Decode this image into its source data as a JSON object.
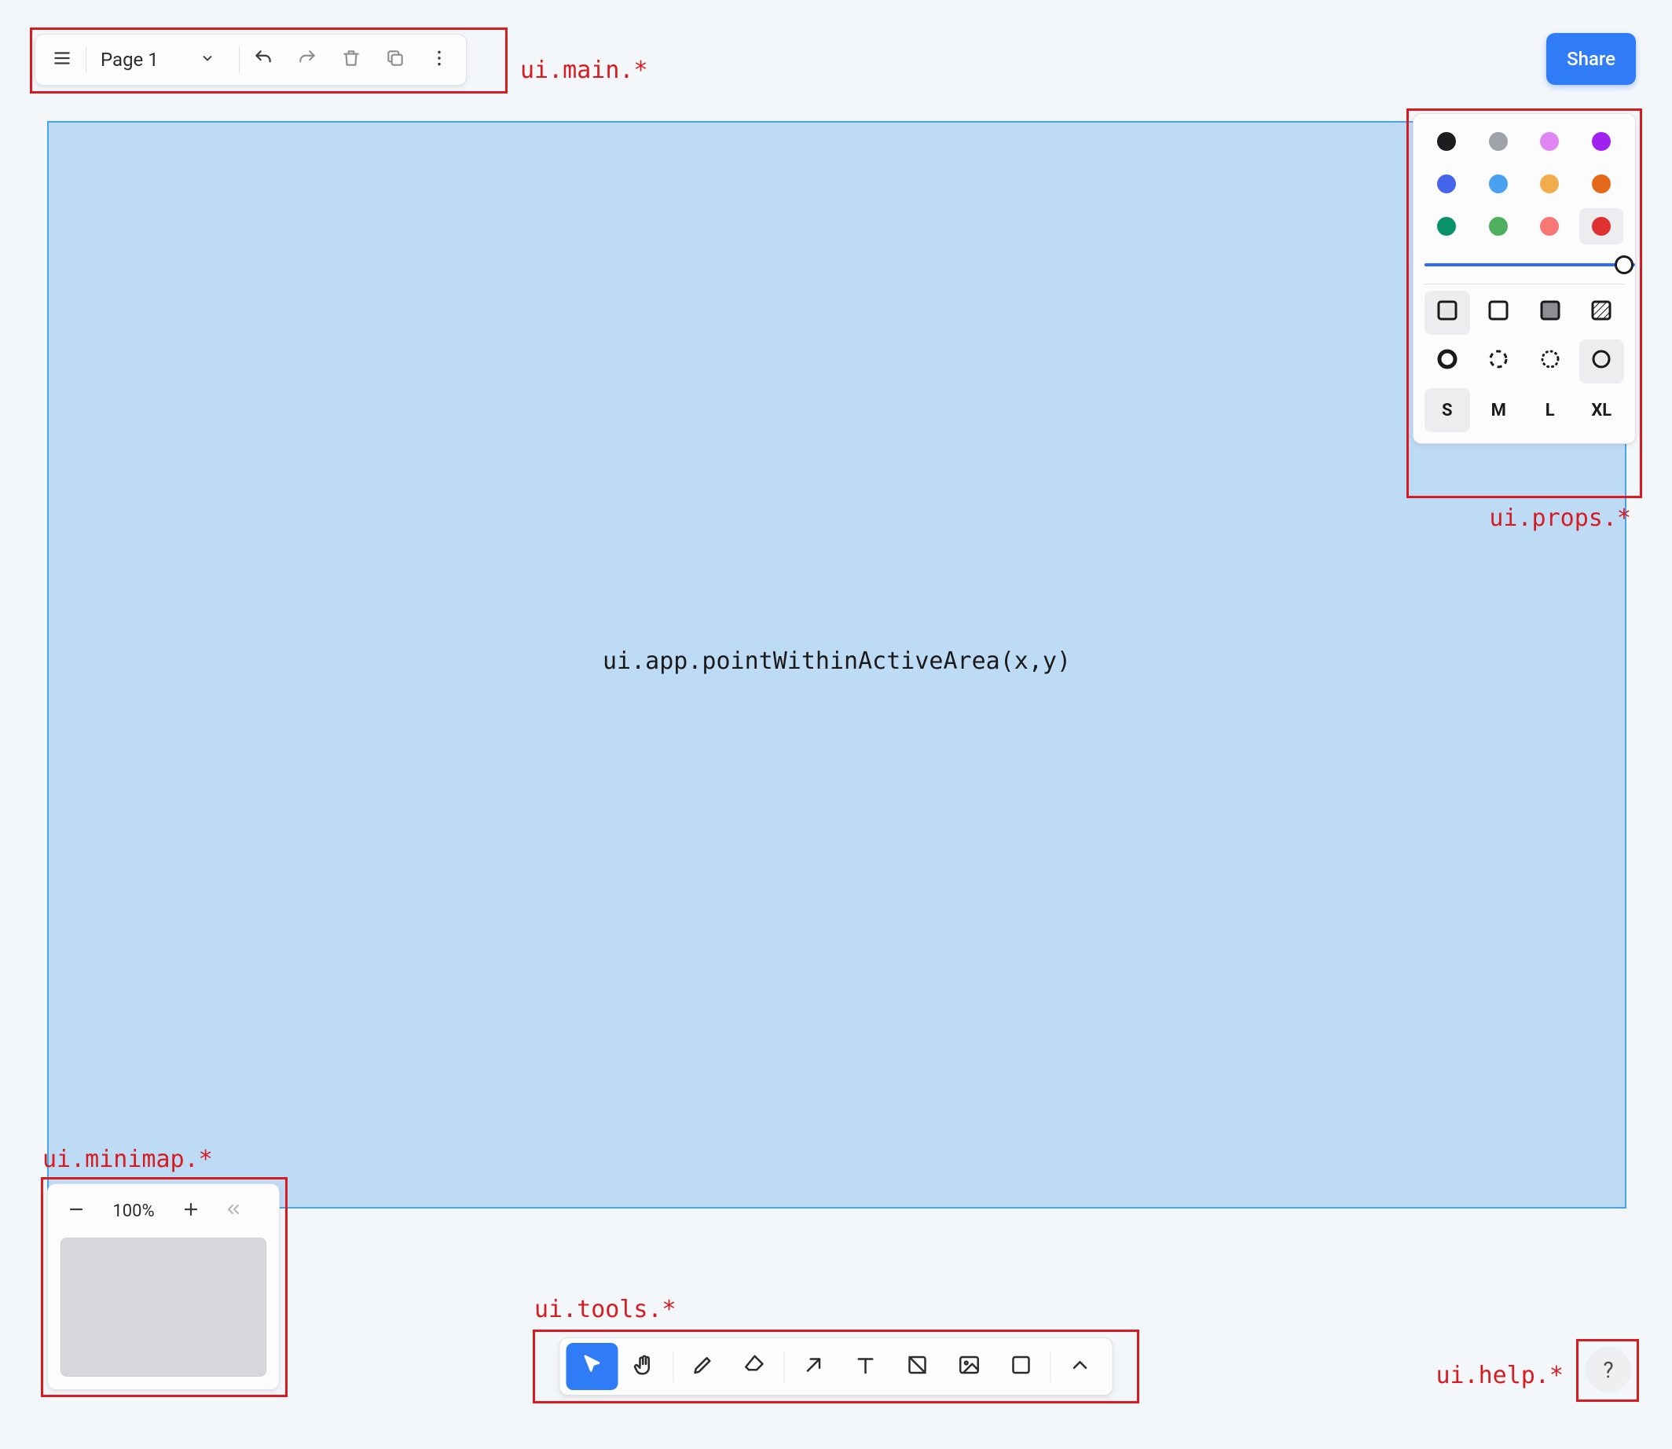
{
  "header": {
    "share_label": "Share"
  },
  "main": {
    "page_label": "Page 1",
    "undo_enabled": true,
    "redo_enabled": false,
    "delete_enabled": false,
    "duplicate_enabled": false
  },
  "canvas": {
    "label": "ui.app.pointWithinActiveArea(x,y)"
  },
  "props": {
    "colors": [
      {
        "name": "black",
        "hex": "#1d1d1f"
      },
      {
        "name": "grey",
        "hex": "#9fa3a9"
      },
      {
        "name": "light-violet",
        "hex": "#e085f4"
      },
      {
        "name": "violet",
        "hex": "#a020f0"
      },
      {
        "name": "blue",
        "hex": "#4465e9"
      },
      {
        "name": "light-blue",
        "hex": "#4ba1f1"
      },
      {
        "name": "yellow",
        "hex": "#f1ac4b"
      },
      {
        "name": "orange",
        "hex": "#e16919"
      },
      {
        "name": "dark-green",
        "hex": "#099268"
      },
      {
        "name": "green",
        "hex": "#4cb05e"
      },
      {
        "name": "light-red",
        "hex": "#f87777"
      },
      {
        "name": "red",
        "hex": "#e03131"
      }
    ],
    "selected_color": "red",
    "opacity": 1.0,
    "fills": [
      "none",
      "semi",
      "solid",
      "pattern"
    ],
    "selected_fill": "none",
    "strokes": [
      "solid",
      "dashed",
      "dotted",
      "draw"
    ],
    "selected_stroke": "draw",
    "sizes": [
      "S",
      "M",
      "L",
      "XL"
    ],
    "selected_size": "S"
  },
  "tools": {
    "items": [
      {
        "name": "select",
        "icon": "cursor"
      },
      {
        "name": "hand",
        "icon": "hand"
      },
      {
        "name": "draw",
        "icon": "pencil"
      },
      {
        "name": "eraser",
        "icon": "eraser"
      },
      {
        "name": "arrow",
        "icon": "arrow-up-right"
      },
      {
        "name": "text",
        "icon": "text"
      },
      {
        "name": "note",
        "icon": "note"
      },
      {
        "name": "asset",
        "icon": "image"
      },
      {
        "name": "shape",
        "icon": "square"
      }
    ],
    "active": "select"
  },
  "minimap": {
    "zoom_label": "100%"
  },
  "help": {
    "label": "?"
  },
  "annotations": {
    "main": "ui.main.*",
    "props": "ui.props.*",
    "minimap": "ui.minimap.*",
    "tools": "ui.tools.*",
    "help": "ui.help.*"
  }
}
